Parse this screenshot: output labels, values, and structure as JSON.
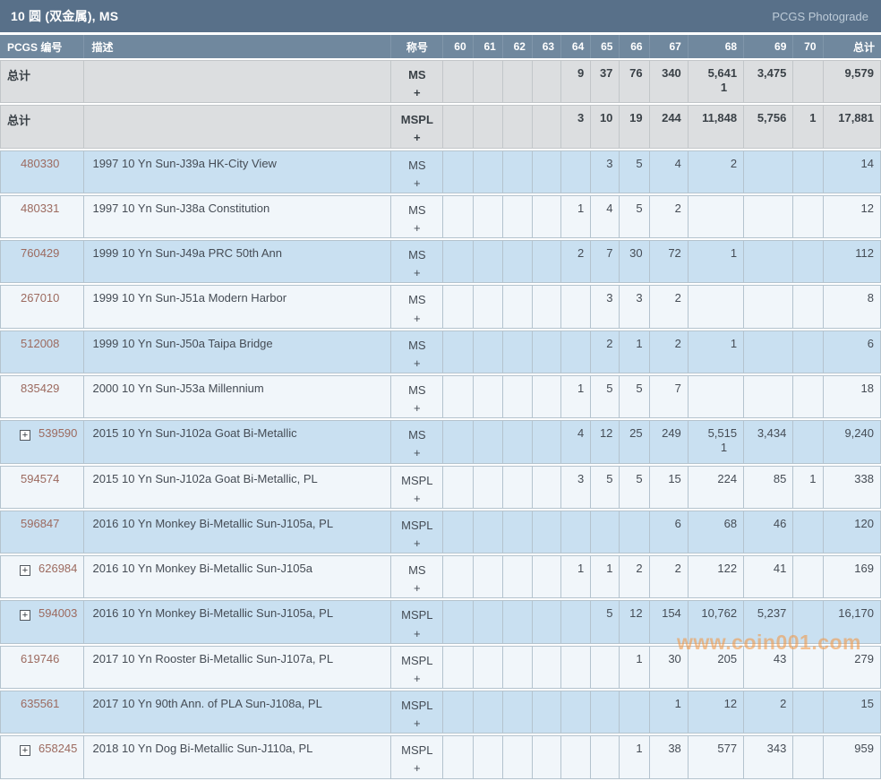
{
  "title_bar": {
    "title": "10 圆 (双金属), MS",
    "photograde_link": "PCGS Photograde"
  },
  "table": {
    "headers": {
      "pcgs_number": "PCGS 编号",
      "description": "描述",
      "designation": "称号",
      "grades": [
        "60",
        "61",
        "62",
        "63",
        "64",
        "65",
        "66",
        "67",
        "68",
        "69",
        "70"
      ],
      "total": "总计"
    },
    "rows": [
      {
        "is_total": true,
        "expandable": false,
        "number": "总计",
        "description": "",
        "designation": "MS",
        "plus": "+",
        "grades": [
          "",
          "",
          "",
          "",
          "9",
          "37",
          "76",
          "340",
          "5,641",
          "3,475",
          ""
        ],
        "sub_grades": [
          "",
          "",
          "",
          "",
          "",
          "",
          "",
          "",
          "1",
          "",
          ""
        ],
        "total": "9,579"
      },
      {
        "is_total": true,
        "expandable": false,
        "number": "总计",
        "description": "",
        "designation": "MSPL",
        "plus": "+",
        "grades": [
          "",
          "",
          "",
          "",
          "3",
          "10",
          "19",
          "244",
          "11,848",
          "5,756",
          "1"
        ],
        "total": "17,881"
      },
      {
        "is_total": false,
        "expandable": false,
        "number": "480330",
        "description": "1997 10 Yn Sun-J39a HK-City View",
        "designation": "MS",
        "plus": "+",
        "grades": [
          "",
          "",
          "",
          "",
          "",
          "3",
          "5",
          "4",
          "2",
          "",
          ""
        ],
        "total": "14"
      },
      {
        "is_total": false,
        "expandable": false,
        "number": "480331",
        "description": "1997 10 Yn Sun-J38a Constitution",
        "designation": "MS",
        "plus": "+",
        "grades": [
          "",
          "",
          "",
          "",
          "1",
          "4",
          "5",
          "2",
          "",
          "",
          ""
        ],
        "total": "12"
      },
      {
        "is_total": false,
        "expandable": false,
        "number": "760429",
        "description": "1999 10 Yn Sun-J49a PRC 50th Ann",
        "designation": "MS",
        "plus": "+",
        "grades": [
          "",
          "",
          "",
          "",
          "2",
          "7",
          "30",
          "72",
          "1",
          "",
          ""
        ],
        "total": "112"
      },
      {
        "is_total": false,
        "expandable": false,
        "number": "267010",
        "description": "1999 10 Yn Sun-J51a Modern Harbor",
        "designation": "MS",
        "plus": "+",
        "grades": [
          "",
          "",
          "",
          "",
          "",
          "3",
          "3",
          "2",
          "",
          "",
          ""
        ],
        "total": "8"
      },
      {
        "is_total": false,
        "expandable": false,
        "number": "512008",
        "description": "1999 10 Yn Sun-J50a Taipa Bridge",
        "designation": "MS",
        "plus": "+",
        "grades": [
          "",
          "",
          "",
          "",
          "",
          "2",
          "1",
          "2",
          "1",
          "",
          ""
        ],
        "total": "6"
      },
      {
        "is_total": false,
        "expandable": false,
        "number": "835429",
        "description": "2000 10 Yn Sun-J53a Millennium",
        "designation": "MS",
        "plus": "+",
        "grades": [
          "",
          "",
          "",
          "",
          "1",
          "5",
          "5",
          "7",
          "",
          "",
          ""
        ],
        "total": "18"
      },
      {
        "is_total": false,
        "expandable": true,
        "number": "539590",
        "description": "2015 10 Yn Sun-J102a Goat Bi-Metallic",
        "designation": "MS",
        "plus": "+",
        "grades": [
          "",
          "",
          "",
          "",
          "4",
          "12",
          "25",
          "249",
          "5,515",
          "3,434",
          ""
        ],
        "sub_grades": [
          "",
          "",
          "",
          "",
          "",
          "",
          "",
          "",
          "1",
          "",
          ""
        ],
        "total": "9,240"
      },
      {
        "is_total": false,
        "expandable": false,
        "number": "594574",
        "description": "2015 10 Yn Sun-J102a Goat Bi-Metallic, PL",
        "designation": "MSPL",
        "plus": "+",
        "grades": [
          "",
          "",
          "",
          "",
          "3",
          "5",
          "5",
          "15",
          "224",
          "85",
          "1"
        ],
        "total": "338"
      },
      {
        "is_total": false,
        "expandable": false,
        "number": "596847",
        "description": "2016 10 Yn Monkey Bi-Metallic Sun-J105a, PL",
        "designation": "MSPL",
        "plus": "+",
        "grades": [
          "",
          "",
          "",
          "",
          "",
          "",
          "",
          "6",
          "68",
          "46",
          ""
        ],
        "total": "120"
      },
      {
        "is_total": false,
        "expandable": true,
        "number": "626984",
        "description": "2016 10 Yn Monkey Bi-Metallic Sun-J105a",
        "designation": "MS",
        "plus": "+",
        "grades": [
          "",
          "",
          "",
          "",
          "1",
          "1",
          "2",
          "2",
          "122",
          "41",
          ""
        ],
        "total": "169"
      },
      {
        "is_total": false,
        "expandable": true,
        "number": "594003",
        "description": "2016 10 Yn Monkey Bi-Metallic Sun-J105a, PL",
        "designation": "MSPL",
        "plus": "+",
        "grades": [
          "",
          "",
          "",
          "",
          "",
          "5",
          "12",
          "154",
          "10,762",
          "5,237",
          ""
        ],
        "total": "16,170"
      },
      {
        "is_total": false,
        "expandable": false,
        "number": "619746",
        "description": "2017 10 Yn Rooster Bi-Metallic Sun-J107a, PL",
        "designation": "MSPL",
        "plus": "+",
        "grades": [
          "",
          "",
          "",
          "",
          "",
          "",
          "1",
          "30",
          "205",
          "43",
          ""
        ],
        "total": "279"
      },
      {
        "is_total": false,
        "expandable": false,
        "number": "635561",
        "description": "2017 10 Yn 90th Ann. of PLA Sun-J108a, PL",
        "designation": "MSPL",
        "plus": "+",
        "grades": [
          "",
          "",
          "",
          "",
          "",
          "",
          "",
          "1",
          "12",
          "2",
          ""
        ],
        "total": "15"
      },
      {
        "is_total": false,
        "expandable": true,
        "number": "658245",
        "description": "2018 10 Yn Dog Bi-Metallic Sun-J110a, PL",
        "designation": "MSPL",
        "plus": "+",
        "grades": [
          "",
          "",
          "",
          "",
          "",
          "",
          "1",
          "38",
          "577",
          "343",
          ""
        ],
        "total": "959"
      }
    ]
  },
  "watermark": "www.coin001.com"
}
